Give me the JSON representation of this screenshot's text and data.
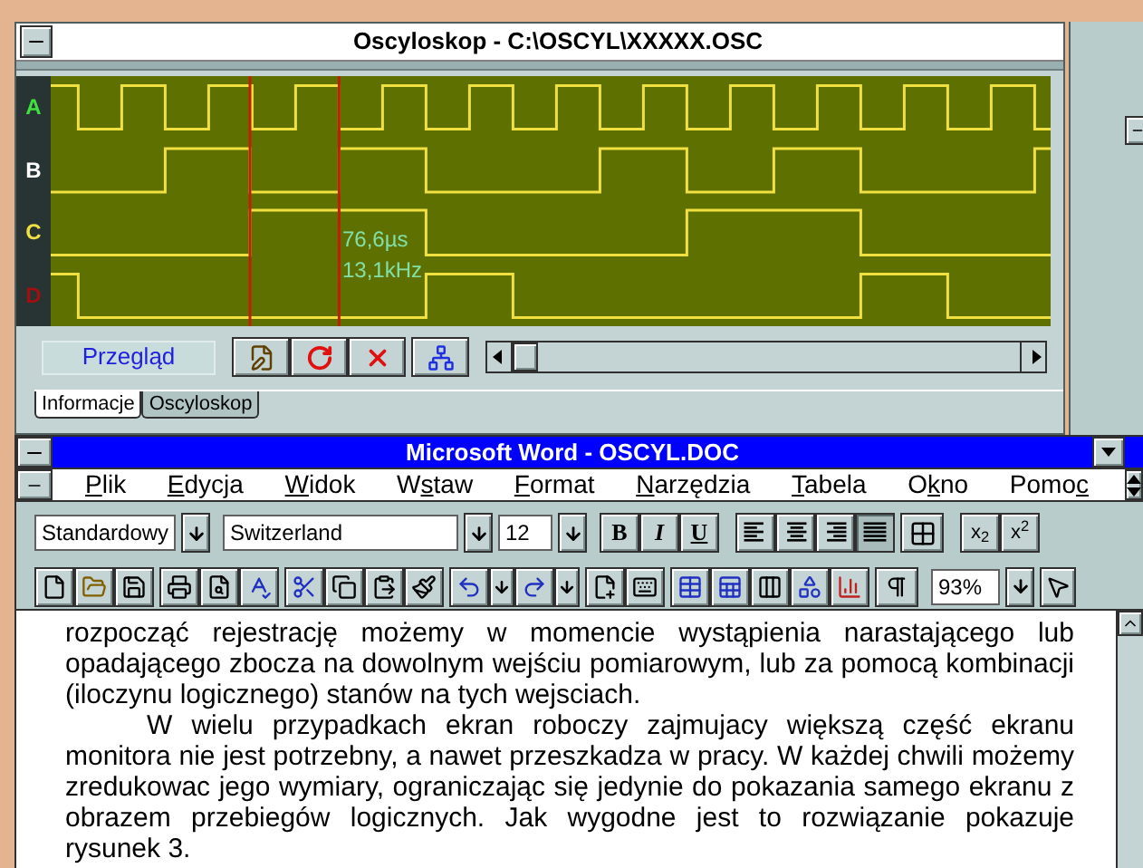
{
  "oscilloscope": {
    "title": "Oscyloskop - C:\\OSCYL\\XXXXX.OSC",
    "channels": [
      {
        "label": "A",
        "color": "#40e040"
      },
      {
        "label": "B",
        "color": "#ffffff"
      },
      {
        "label": "C",
        "color": "#f0e040"
      },
      {
        "label": "D",
        "color": "#a01010"
      }
    ],
    "cursor_readings": [
      "76,6µs",
      "13,1kHz"
    ],
    "mode_field": "Przegląd",
    "tabs": [
      {
        "label": "Informacje",
        "selected": true
      },
      {
        "label": "Oscyloskop",
        "selected": false
      }
    ]
  },
  "word": {
    "title": "Microsoft Word - OSCYL.DOC",
    "menu": [
      {
        "key": "P",
        "post": "lik"
      },
      {
        "key": "E",
        "post": "dycja"
      },
      {
        "key": "W",
        "post": "idok"
      },
      {
        "pre": "W",
        "key": "s",
        "post": "taw"
      },
      {
        "key": "F",
        "post": "ormat"
      },
      {
        "key": "N",
        "post": "arzędzia"
      },
      {
        "key": "T",
        "post": "abela"
      },
      {
        "pre": "O",
        "key": "k",
        "post": "no"
      },
      {
        "pre": "Pomo",
        "key": "c"
      }
    ],
    "style": "Standardowy",
    "font": "Switzerland",
    "size": "12",
    "format_buttons": [
      {
        "label": "B",
        "kind": "bold"
      },
      {
        "label": "I",
        "kind": "italic"
      },
      {
        "label": "U",
        "kind": "underline"
      }
    ],
    "alignment": [
      {
        "kind": "left",
        "selected": false
      },
      {
        "kind": "center",
        "selected": false
      },
      {
        "kind": "right",
        "selected": false
      },
      {
        "kind": "justify",
        "selected": true
      }
    ],
    "script_buttons": [
      "x$_{2}$",
      "x$^{2}$"
    ],
    "zoom": "93%",
    "paragraphs": [
      {
        "text": "rozpocząć rejestrację możemy w momencie wystąpienia narastającego lub opadającego zbocza na dowolnym wejściu pomiarowym, lub za pomocą kombinacji (iloczynu logicznego) stanów na tych wejsciach.",
        "indent": false
      },
      {
        "text": "W wielu przypadkach ekran roboczy zajmujacy większą część ekranu monitora nie jest potrzebny, a nawet przeszkadza w pracy. W każdej chwili możemy zredukowac jego wymiary, ograniczając się jedynie do pokazania samego ekranu z obrazem przebiegów logicznych. Jak wygodne jest to rozwiązanie pokazuje rysunek 3.",
        "indent": true
      }
    ]
  }
}
